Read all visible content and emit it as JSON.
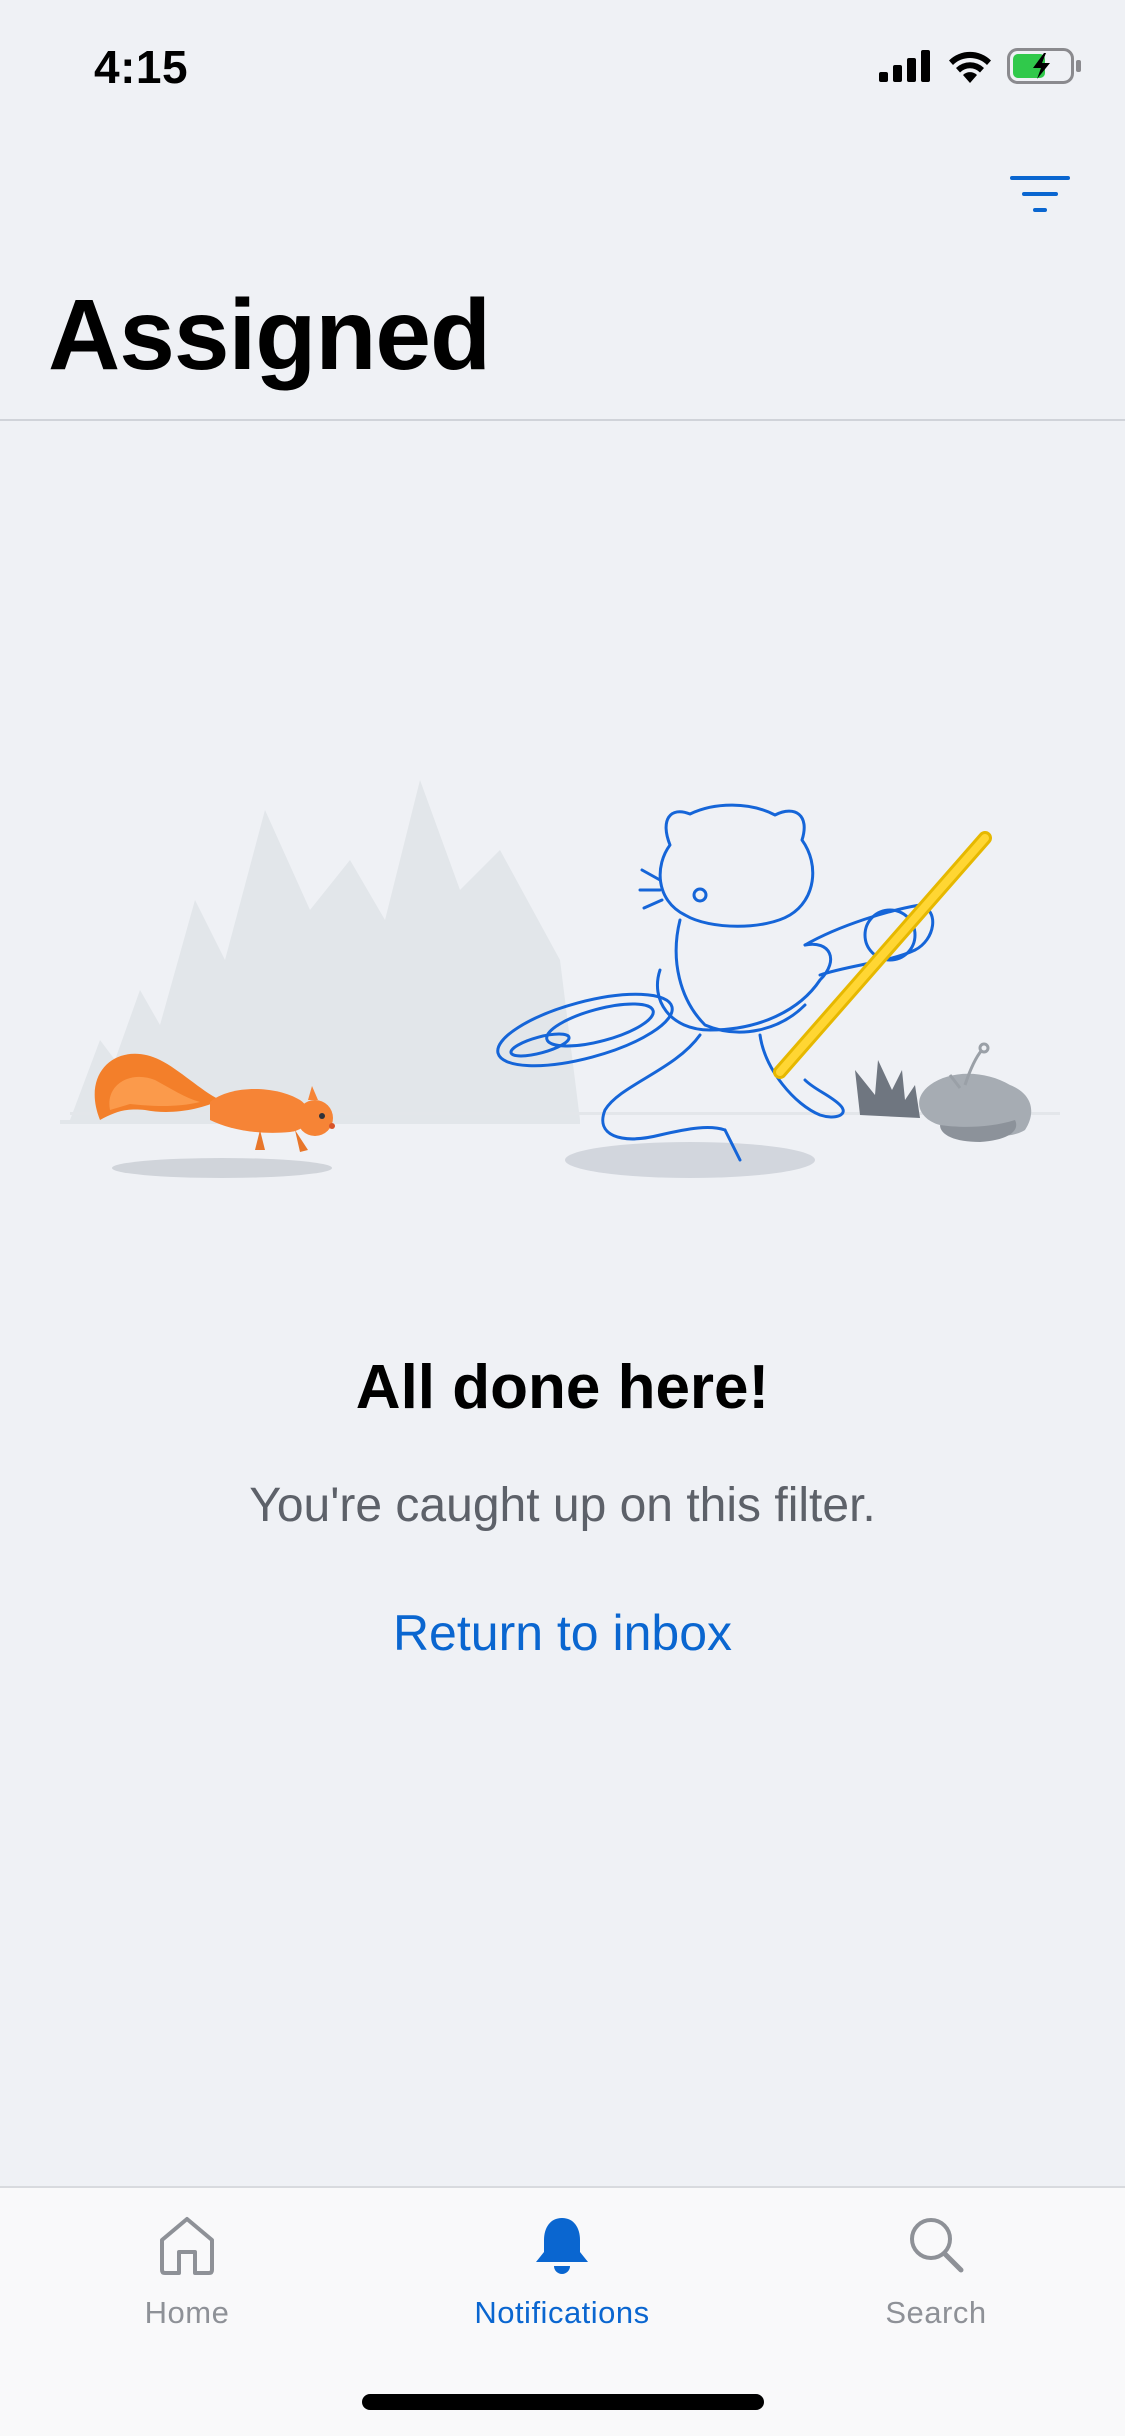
{
  "status_bar": {
    "time": "4:15",
    "signal_icon": "cellular-signal-icon",
    "wifi_icon": "wifi-icon",
    "battery_icon": "battery-charging-icon",
    "battery_color": "#30c94b"
  },
  "header": {
    "title": "Assigned",
    "filter_icon": "filter-icon"
  },
  "empty_state": {
    "illustration": "octocat-sweeping-illustration",
    "title": "All done here!",
    "subtitle": "You're caught up on this filter.",
    "action_label": "Return to inbox"
  },
  "tab_bar": {
    "tabs": [
      {
        "label": "Home",
        "icon": "home-icon",
        "active": false
      },
      {
        "label": "Notifications",
        "icon": "bell-icon",
        "active": true
      },
      {
        "label": "Search",
        "icon": "search-icon",
        "active": false
      }
    ]
  },
  "colors": {
    "accent": "#0a66d0",
    "background": "#eff1f5",
    "inactive": "#8e9197"
  }
}
